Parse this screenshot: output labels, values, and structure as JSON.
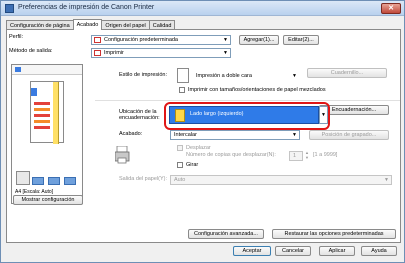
{
  "window": {
    "title": "Preferencias de impresión de Canon Printer"
  },
  "tabs": [
    {
      "label": "Configuración de página"
    },
    {
      "label": "Acabado"
    },
    {
      "label": "Origen del papel"
    },
    {
      "label": "Calidad"
    }
  ],
  "profile": {
    "label": "Perfil:",
    "value": "Configuración predeterminada",
    "add_btn": "Agregar(1)...",
    "edit_btn": "Editar(2)..."
  },
  "output": {
    "label": "Método de salida:",
    "value": "Imprimir"
  },
  "print_style": {
    "label": "Estilo de impresión:",
    "value": "Impresión a doble cara",
    "booklet_btn": "Cuadernillo...",
    "mixed_label": "Imprimir con tamaños/orientaciones de papel mezclados"
  },
  "binding": {
    "label1": "Ubicación de la",
    "label2": "encuadernación:",
    "value": "Lado largo (izquierdo)",
    "binding_btn": "Encuadernación..."
  },
  "finishing": {
    "label": "Acabado:",
    "value": "Intercalar",
    "staple_btn": "Posición de grapado..."
  },
  "offset": {
    "label": "Desplazar",
    "copies_label": "Número de copias que desplazar(N):",
    "copies_value": "1",
    "copies_range": "[1 a 9999]",
    "rotate_label": "Girar"
  },
  "output_tray": {
    "label": "Salida del papel(Y):",
    "value": "Auto"
  },
  "preview": {
    "caption": "A4 [Escala: Auto]"
  },
  "show_settings_btn": "Mostrar configuración",
  "advanced_btn": "Configuración avanzada...",
  "restore_btn": "Restaurar las opciones predeterminadas",
  "footer": {
    "accept": "Aceptar",
    "cancel": "Cancelar",
    "apply": "Aplicar",
    "help": "Ayuda"
  }
}
